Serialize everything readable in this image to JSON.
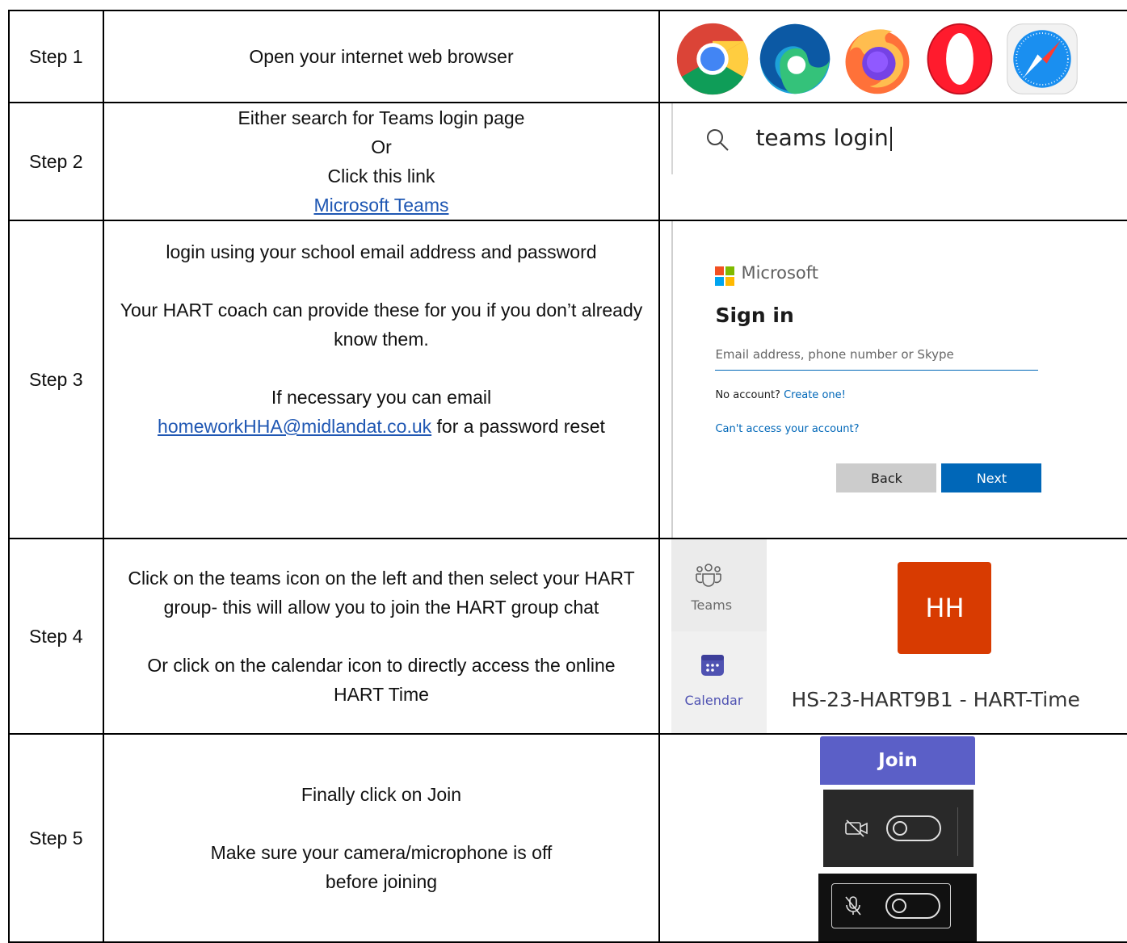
{
  "rows": [
    {
      "label": "Step 1",
      "lines": [
        "Open your internet web browser"
      ]
    },
    {
      "label": "Step 2",
      "lines": [
        "Either search for Teams login page",
        "Or",
        "Click this link"
      ],
      "link": "Microsoft Teams"
    },
    {
      "label": "Step 3",
      "line1": "login using your school email address and password",
      "line2": "Your HART coach can provide these for you if you don’t already know them.",
      "line3": "If necessary you can email",
      "email": "homeworkHHA@midlandat.co.uk",
      "line3_tail": " for a password reset"
    },
    {
      "label": "Step 4",
      "line1": "Click on the teams icon on the left and then select your HART group- this will allow you to join the HART group chat",
      "line2": "Or click on the calendar icon to directly access the online HART Time"
    },
    {
      "label": "Step 5",
      "line1": "Finally click on Join",
      "line2": "Make sure your camera/microphone is off before joining"
    }
  ],
  "browser_icons": [
    "chrome-icon",
    "edge-icon",
    "firefox-icon",
    "opera-icon",
    "safari-icon"
  ],
  "search": {
    "icon": "search-icon",
    "query": "teams login"
  },
  "signin": {
    "brand": "Microsoft",
    "title": "Sign in",
    "email_placeholder": "Email address, phone number or Skype",
    "no_account": "No account?",
    "create_link": "Create one!",
    "cant_access": "Can't access your account?",
    "back_label": "Back",
    "next_label": "Next",
    "brand_colors": [
      "#f25022",
      "#7fba00",
      "#00a4ef",
      "#ffb900"
    ]
  },
  "teams": {
    "teams_label": "Teams",
    "calendar_label": "Calendar",
    "tile_initials": "HH",
    "tile_color": "#d83b01",
    "group_name": "HS-23-HART9B1 - HART-Time",
    "accent": "#4f52b2"
  },
  "join": {
    "label": "Join",
    "button_color": "#5b5fc7",
    "camera_icon": "camera-off-icon",
    "mic_icon": "mic-off-icon"
  }
}
